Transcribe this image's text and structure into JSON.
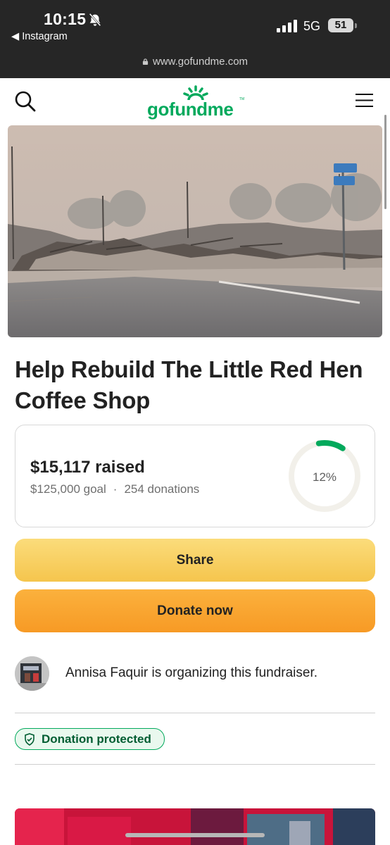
{
  "status_bar": {
    "time": "10:15",
    "back_app": "Instagram",
    "network": "5G",
    "battery": "51"
  },
  "browser": {
    "url": "www.gofundme.com"
  },
  "header": {
    "logo": "gofundme",
    "logo_tm": "TM"
  },
  "campaign": {
    "title": "Help Rebuild The Little Red Hen Coffee Shop",
    "raised": "$15,117 raised",
    "goal": "$125,000 goal",
    "separator": "·",
    "donations": "254 donations",
    "progress_label": "12%",
    "progress_fraction": 0.12
  },
  "actions": {
    "share": "Share",
    "donate": "Donate now"
  },
  "organizer": {
    "text": "Annisa Faquir is organizing this fundraiser."
  },
  "badge": {
    "label": "Donation protected"
  },
  "icons": {
    "search": "search-icon",
    "menu": "menu-icon",
    "bell": "bell-slash-icon",
    "shield": "shield-check-icon",
    "lock": "lock-icon"
  },
  "colors": {
    "brand_green": "#02a95c",
    "share_yellow": "#f8ce62",
    "donate_orange": "#f8a22f",
    "chrome_dark": "#262626"
  }
}
